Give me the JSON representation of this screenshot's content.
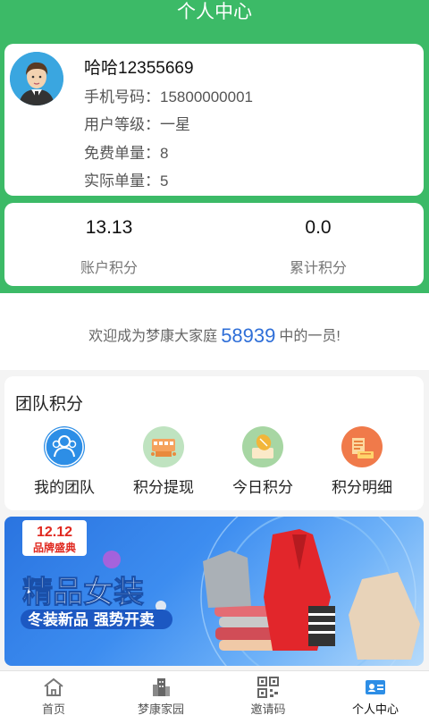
{
  "header": {
    "title": "个人中心"
  },
  "profile": {
    "name": "哈哈12355669",
    "lines": [
      {
        "label": "手机号码：",
        "value": "15800000001"
      },
      {
        "label": "用户等级：",
        "value": "一星"
      },
      {
        "label": "免费单量：",
        "value": "8"
      },
      {
        "label": "实际单量：",
        "value": "5"
      }
    ]
  },
  "points": [
    {
      "value": "13.13",
      "label": "账户积分"
    },
    {
      "value": "0.0",
      "label": "累计积分"
    }
  ],
  "welcome": {
    "prefix": "欢迎成为梦康大家庭",
    "count": "58939",
    "suffix": "中的一员!"
  },
  "team": {
    "title": "团队积分",
    "items": [
      {
        "label": "我的团队",
        "icon": "team-icon",
        "color": "#2d8ee6"
      },
      {
        "label": "积分提现",
        "icon": "withdraw-icon",
        "color": "#bfe3c0"
      },
      {
        "label": "今日积分",
        "icon": "today-points-icon",
        "color": "#a7d6a3"
      },
      {
        "label": "积分明细",
        "icon": "points-detail-icon",
        "color": "#f07a4a"
      }
    ]
  },
  "banner": {
    "badge_top": "12.12",
    "badge_bottom": "品牌盛典",
    "headline": "精品女装",
    "subline": "冬装新品 强势开卖"
  },
  "tabbar": [
    {
      "label": "首页",
      "icon": "home-icon"
    },
    {
      "label": "梦康家园",
      "icon": "building-icon"
    },
    {
      "label": "邀请码",
      "icon": "qr-code-icon"
    },
    {
      "label": "个人中心",
      "icon": "profile-card-icon",
      "active": true
    }
  ],
  "colors": {
    "primary": "#3cba67",
    "accent_number": "#2f6fd8",
    "tab_active": "#2d8ee6"
  }
}
